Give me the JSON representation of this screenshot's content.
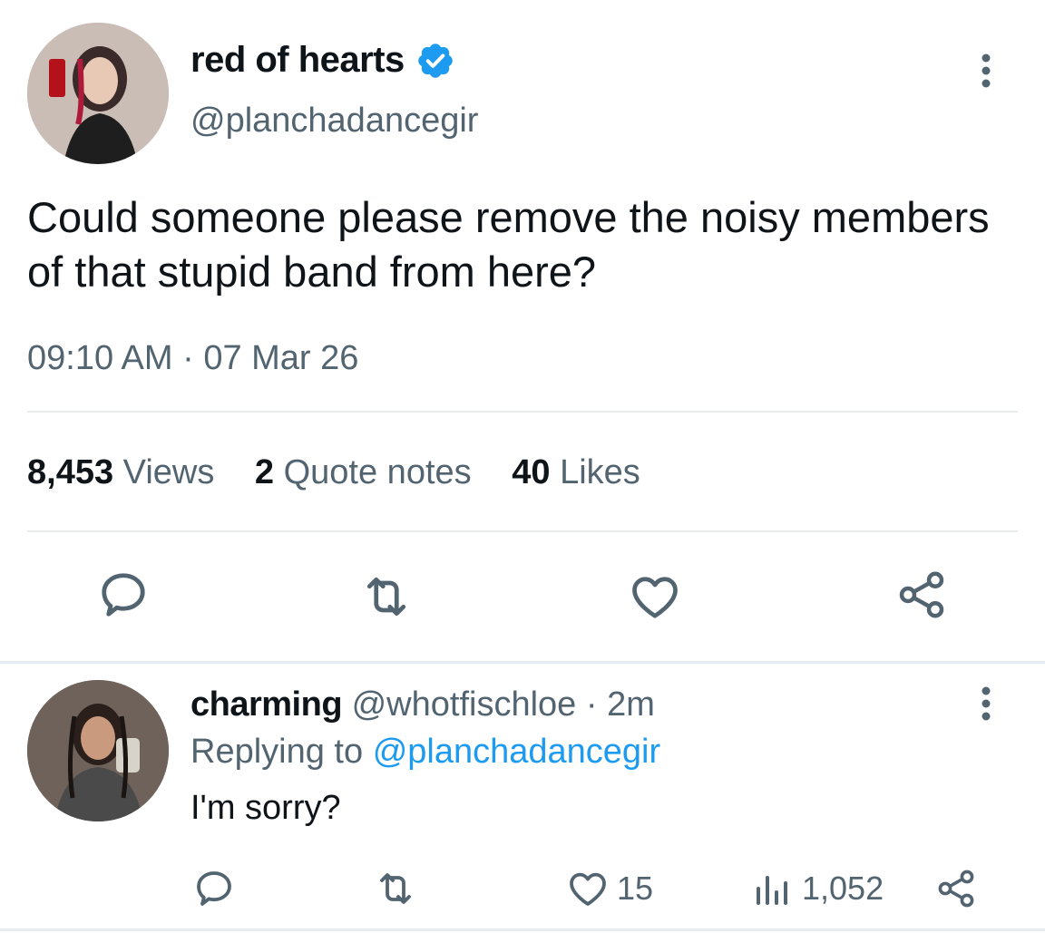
{
  "tweet": {
    "author_name": "red of hearts",
    "author_handle": "@planchadancegir",
    "text": "Could someone please remove the noisy members of that stupid band from here?",
    "timestamp": "09:10 AM · 07 Mar 26",
    "stats": {
      "views_count": "8,453",
      "views_label": "Views",
      "quotes_count": "2",
      "quotes_label": "Quote notes",
      "likes_count": "40",
      "likes_label": "Likes"
    },
    "icons": [
      "reply-icon",
      "retweet-icon",
      "like-icon",
      "share-icon",
      "more-icon",
      "verified-badge-icon"
    ]
  },
  "reply": {
    "author_name": "charming",
    "author_handle": "@whotfischloe",
    "separator": "·",
    "time": "2m",
    "replying_prefix": "Replying to",
    "replying_handle": "@planchadancegir",
    "text": "I'm sorry?",
    "likes_count": "15",
    "views_count": "1,052",
    "icons": [
      "reply-icon",
      "retweet-icon",
      "like-icon",
      "views-icon",
      "share-icon",
      "more-icon"
    ]
  },
  "colors": {
    "text_primary": "#0f1419",
    "text_secondary": "#536471",
    "accent_blue": "#1d9bf0",
    "divider": "#e6ecf0"
  }
}
